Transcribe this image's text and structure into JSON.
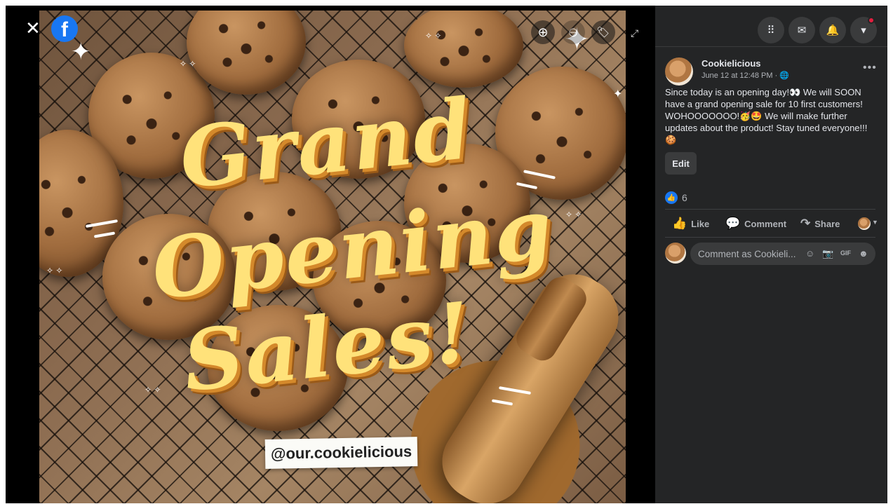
{
  "viewer": {
    "close_glyph": "✕",
    "fb_logo_letter": "f",
    "headline": [
      "Grand",
      "Opening",
      "Sales!"
    ],
    "handle_text": "@our.cookielicious",
    "zoom_in_glyph": "⊕",
    "zoom_out_glyph": "⊖",
    "tag_glyph": "🏷",
    "expand_glyph": "⤢"
  },
  "topbar": {
    "icons": [
      "menu-grid-icon",
      "messenger-icon",
      "notifications-icon",
      "account-caret-icon"
    ],
    "glyphs": [
      "⠿",
      "✉",
      "🔔",
      "▾"
    ]
  },
  "post": {
    "author": "Cookielicious",
    "meta": "June 12 at 12:48 PM · 🌐",
    "more_glyph": "•••",
    "text": "Since today is an opening day!👀 We will SOON have a grand opening sale for 10 first customers! WOHOOOOOOO!🥳🤩 We will make further updates about the product! Stay tuned everyone!!! 🍪",
    "edit_label": "Edit",
    "like_glyph": "👍",
    "reaction_count": "6",
    "actions": {
      "like": {
        "glyph": "👍",
        "label": "Like"
      },
      "comment": {
        "glyph": "💬",
        "label": "Comment"
      },
      "share": {
        "glyph": "↷",
        "label": "Share"
      }
    },
    "caret_glyph": "▼",
    "comment_placeholder": "Comment as Cookieli...",
    "comment_icons": [
      "☺",
      "📷",
      "GIF",
      "☻"
    ]
  },
  "colors": {
    "panel_bg": "#242526",
    "brand_blue": "#1877f2",
    "headline_yellow": "#ffe27a",
    "notif_red": "#e41e3f"
  }
}
